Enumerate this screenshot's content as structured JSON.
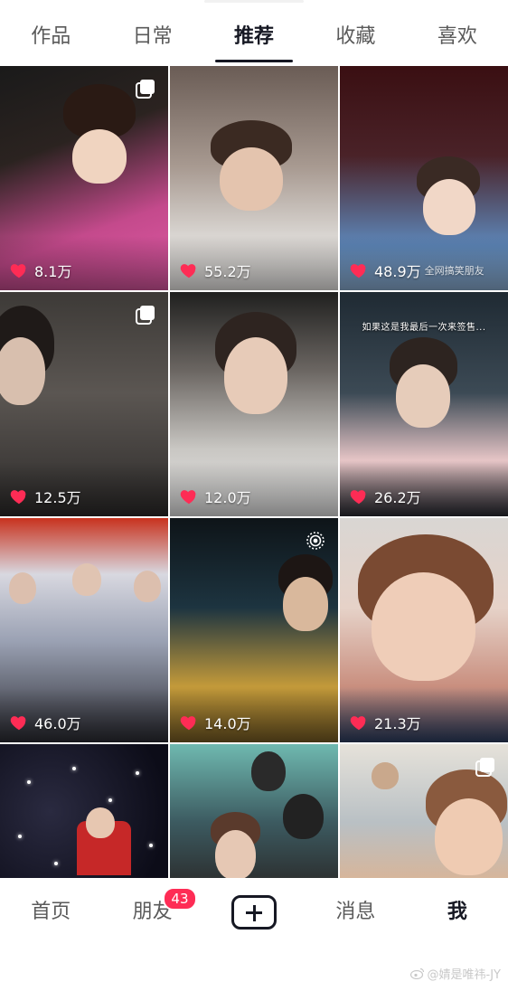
{
  "tabs": [
    {
      "label": "作品"
    },
    {
      "label": "日常"
    },
    {
      "label": "推荐",
      "active": true
    },
    {
      "label": "收藏"
    },
    {
      "label": "喜欢"
    }
  ],
  "grid": {
    "items": [
      {
        "likes": "8.1万",
        "badge": "multi-image-icon"
      },
      {
        "likes": "55.2万"
      },
      {
        "likes": "48.9万",
        "tag": "全网搞笑朋友"
      },
      {
        "likes": "12.5万",
        "badge": "multi-image-icon"
      },
      {
        "likes": "12.0万"
      },
      {
        "likes": "26.2万",
        "caption": "如果这是我最后一次来签售..."
      },
      {
        "likes": "46.0万"
      },
      {
        "likes": "14.0万",
        "badge": "live-photo-icon"
      },
      {
        "likes": "21.3万"
      },
      {
        "likes": ""
      },
      {
        "likes": ""
      },
      {
        "likes": "",
        "badge": "multi-image-icon"
      }
    ]
  },
  "bottom_nav": {
    "home": "首页",
    "friends": "朋友",
    "friends_badge": "43",
    "create_icon": "plus-icon",
    "messages": "消息",
    "me": "我"
  },
  "watermark": "@婧是唯祎-JY",
  "colors": {
    "accent": "#fe2c55",
    "text_active": "#161823",
    "text_inactive": "#5a5a5a"
  }
}
